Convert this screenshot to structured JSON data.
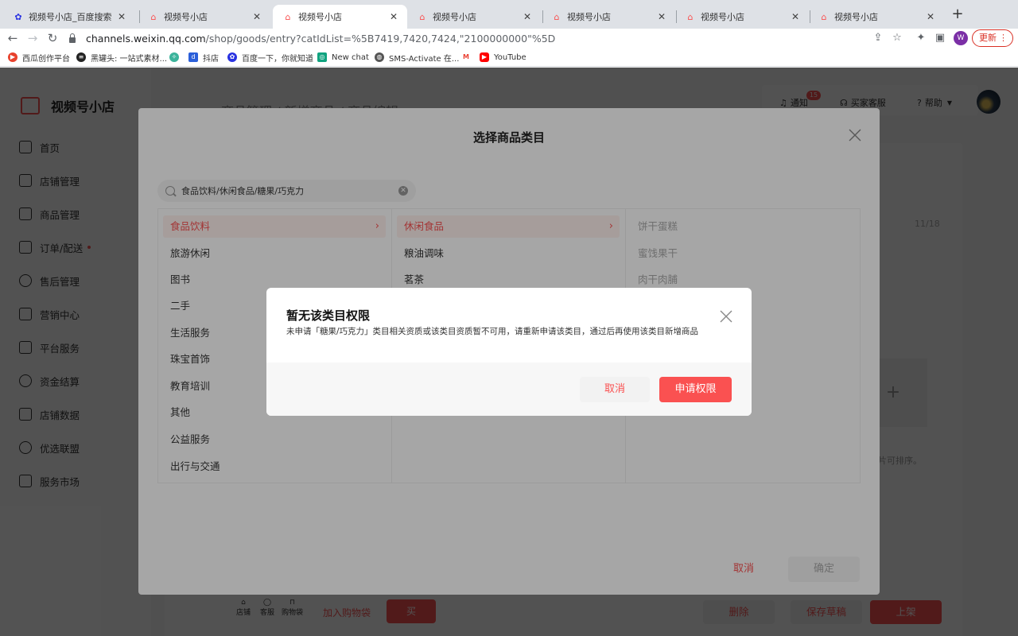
{
  "browser": {
    "tabs": [
      {
        "title": "视频号小店_百度搜索",
        "icon": "baidu-icon"
      },
      {
        "title": "视频号小店",
        "icon": "shop-icon"
      },
      {
        "title": "视频号小店",
        "icon": "shop-icon"
      },
      {
        "title": "视频号小店",
        "icon": "shop-icon"
      },
      {
        "title": "视频号小店",
        "icon": "shop-icon"
      },
      {
        "title": "视频号小店",
        "icon": "shop-icon"
      },
      {
        "title": "视频号小店",
        "icon": "shop-icon"
      }
    ],
    "active_tab": 2,
    "url_host": "channels.weixin.qq.com",
    "url_path": "/shop/goods/entry?catIdList=%5B7419,7420,7424,\"2100000000\"%5D",
    "profile_letter": "W",
    "update_label": "更新",
    "bookmarks": [
      {
        "label": "西瓜创作平台",
        "color": "#e8412c"
      },
      {
        "label": "黑罐头: 一站式素材...",
        "color": "#222222"
      },
      {
        "label": "",
        "color": "#3bb39b"
      },
      {
        "label": "抖店",
        "color": "#2b5fd9"
      },
      {
        "label": "百度一下，你就知道",
        "color": "#2932e1"
      },
      {
        "label": "New chat",
        "color": "#10a37f"
      },
      {
        "label": "SMS-Activate 在...",
        "color": "#555555"
      },
      {
        "label": "",
        "color": "#ea4335"
      },
      {
        "label": "YouTube",
        "color": "#ff0000"
      }
    ]
  },
  "app": {
    "logo_text": "视频号小店",
    "breadcrumb": "商品管理 / 新增商品 / 商品编辑",
    "sidebar": [
      {
        "label": "首页",
        "icon": "home-icon"
      },
      {
        "label": "店铺管理",
        "icon": "store-icon"
      },
      {
        "label": "商品管理",
        "icon": "bag-icon"
      },
      {
        "label": "订单/配送",
        "icon": "order-icon",
        "dot": true
      },
      {
        "label": "售后管理",
        "icon": "headset-icon"
      },
      {
        "label": "营销中心",
        "icon": "coupon-icon"
      },
      {
        "label": "平台服务",
        "icon": "briefcase-icon"
      },
      {
        "label": "资金结算",
        "icon": "yen-icon"
      },
      {
        "label": "店铺数据",
        "icon": "chart-icon"
      },
      {
        "label": "优选联盟",
        "icon": "network-icon"
      },
      {
        "label": "服务市场",
        "icon": "grid-icon"
      }
    ],
    "topbar": {
      "notify_label": "通知",
      "notify_count": "15",
      "service_label": "买家客服",
      "help_label": "帮助"
    },
    "counter": "11/18",
    "image_hint": "图片可排序。",
    "preview_actions": {
      "store": "店铺",
      "service": "客服",
      "cart": "购物袋",
      "add_cart": "加入购物袋",
      "buy": "买"
    },
    "page_buttons": {
      "delete": "删除",
      "save_draft": "保存草稿",
      "publish": "上架"
    }
  },
  "category_dialog": {
    "title": "选择商品类目",
    "search_value": "食品饮料/休闲食品/糖果/巧克力",
    "level1": [
      "食品饮料",
      "旅游休闲",
      "图书",
      "二手",
      "生活服务",
      "珠宝首饰",
      "教育培训",
      "其他",
      "公益服务",
      "出行与交通"
    ],
    "level1_selected": 0,
    "level2": [
      "休闲食品",
      "粮油调味",
      "茗茶"
    ],
    "level2_selected": 0,
    "level3": [
      "饼干蛋糕",
      "蜜饯果干",
      "肉干肉脯"
    ],
    "cancel_label": "取消",
    "ok_label": "确定"
  },
  "alert": {
    "title": "暂无该类目权限",
    "message": "未申请「糖果/巧克力」类目相关资质或该类目资质暂不可用，请重新申请该类目，通过后再使用该类目新增商品",
    "cancel_label": "取消",
    "apply_label": "申请权限"
  },
  "colors": {
    "brand": "#fa5151",
    "selected_bg": "#fff1ee"
  }
}
